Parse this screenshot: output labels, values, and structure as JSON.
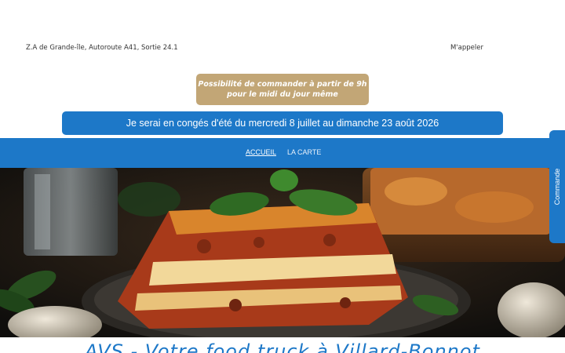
{
  "header": {
    "address": "Z.A de Grande-île, Autoroute A41, Sortie 24.1",
    "call_label": "M'appeler"
  },
  "order_note": {
    "line1": "Possibilité de commander à partir de 9h",
    "line2": "pour le midi du jour même"
  },
  "holiday_banner": "Je serai en congés d'été du mercredi 8 juillet au dimanche 23 août 2026",
  "nav": {
    "items": [
      {
        "label": "ACCUEIL",
        "active": true
      },
      {
        "label": "LA CARTE",
        "active": false
      }
    ]
  },
  "side_tab": "Commande",
  "headline": "AVS - Votre food truck à Villard-Bonnot",
  "colors": {
    "brand_blue": "#1d78c8",
    "note_tan": "#c2a676"
  }
}
